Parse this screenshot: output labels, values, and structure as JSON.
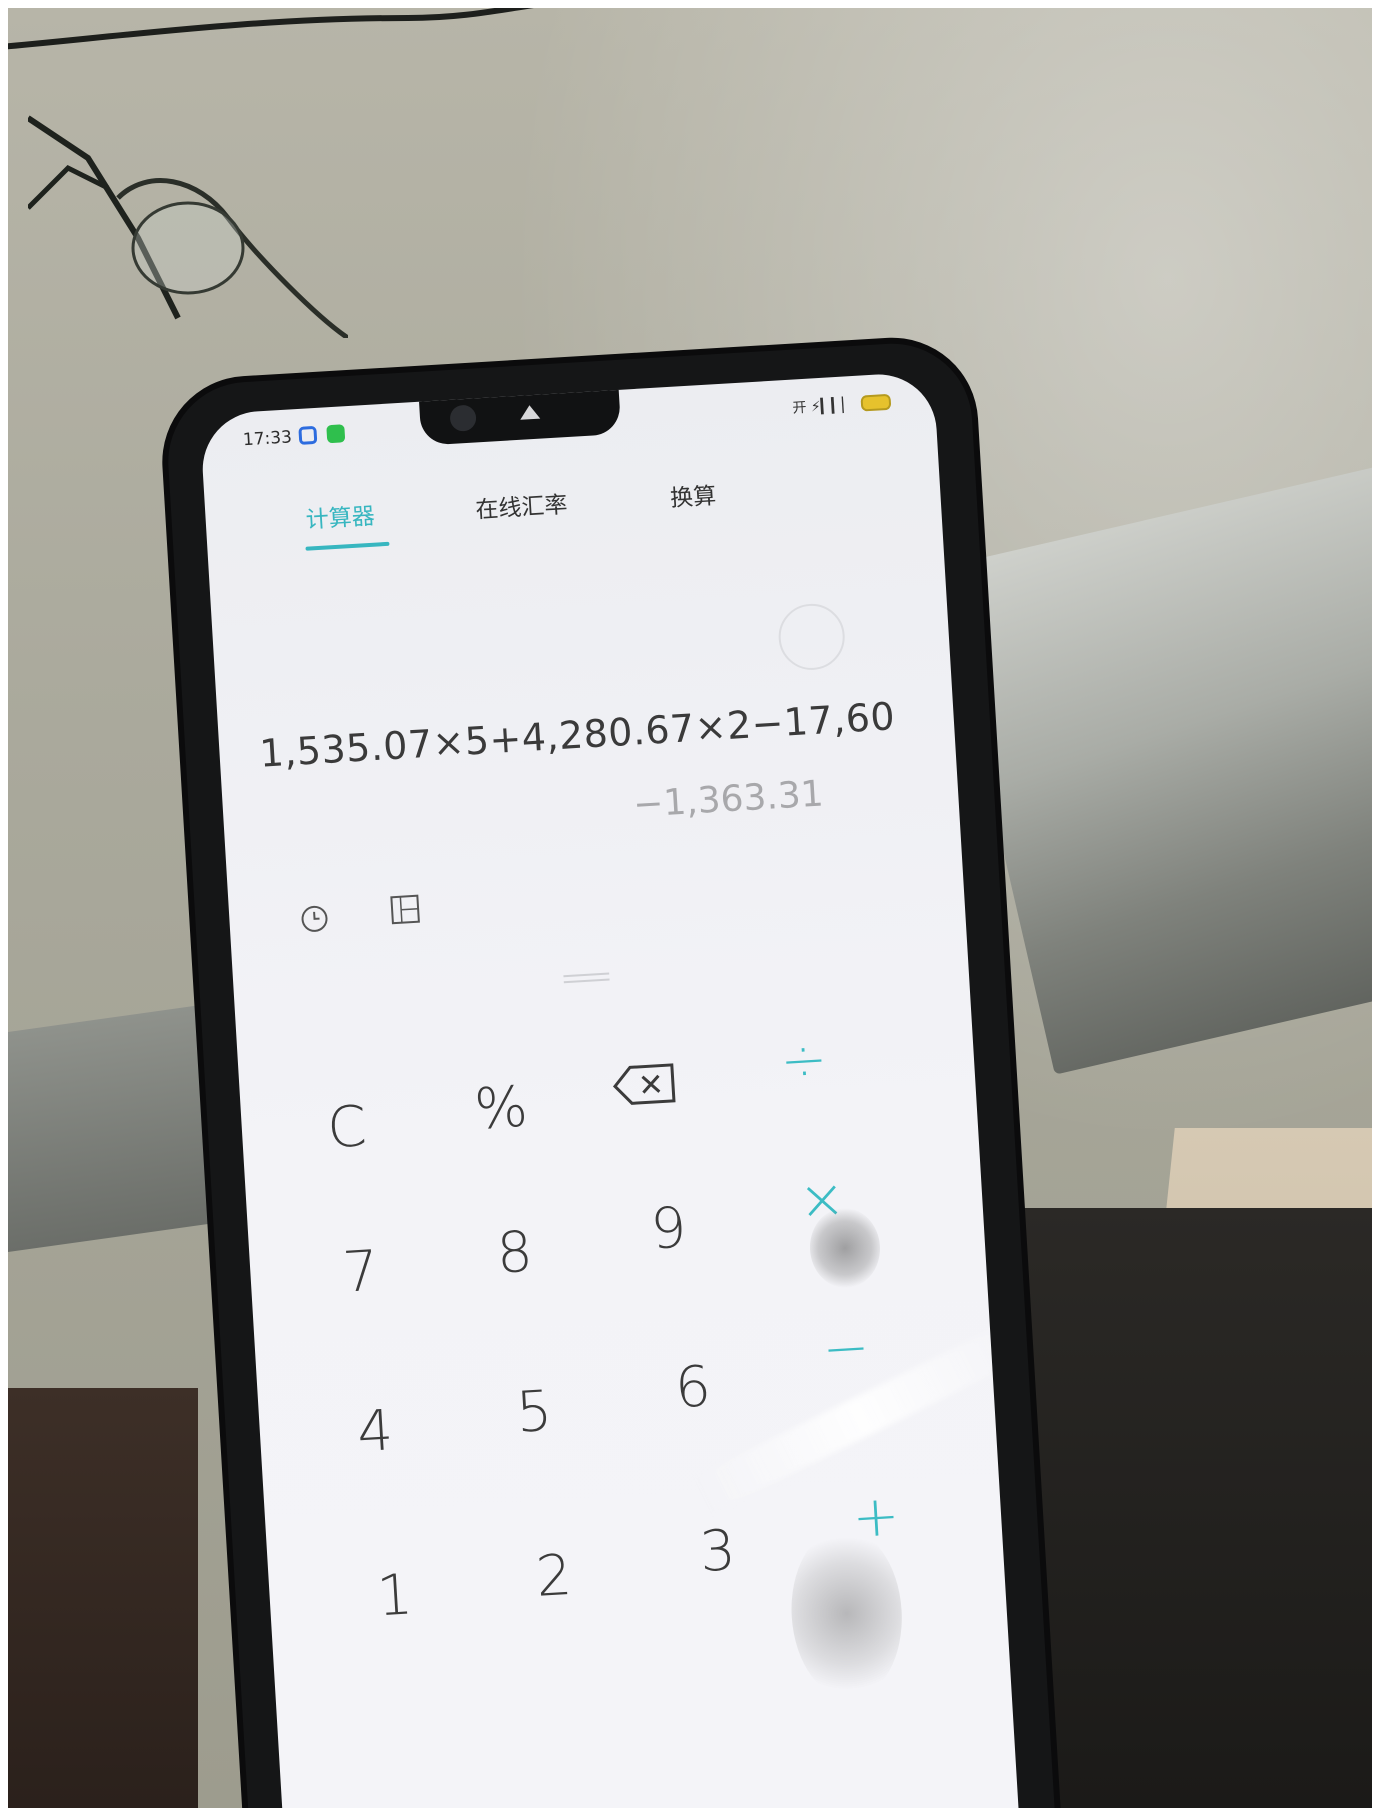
{
  "status_bar": {
    "time": "17:33",
    "right_indicators": "开 ⚡▎▎▏",
    "app_icon_colors": [
      "#2d6cdf",
      "#2fbf4d"
    ]
  },
  "tabs": [
    {
      "label": "计算器",
      "active": true
    },
    {
      "label": "在线汇率",
      "active": false
    },
    {
      "label": "换算",
      "active": false
    }
  ],
  "display": {
    "expression": "1,535.07×5+4,280.67×2−17,60",
    "result": "−1,363.31"
  },
  "tools": {
    "history_icon": "clock-icon",
    "unit_icon": "unit-converter-icon"
  },
  "keypad": {
    "row1": [
      "C",
      "%",
      "backspace",
      "÷"
    ],
    "row2": [
      "7",
      "8",
      "9",
      "×"
    ],
    "row3": [
      "4",
      "5",
      "6",
      "−"
    ],
    "row4": [
      "1",
      "2",
      "3",
      "+"
    ]
  },
  "colors": {
    "accent": "#37b6c0",
    "screen_bg": "#f2f2f6",
    "phone_frame": "#151617"
  }
}
